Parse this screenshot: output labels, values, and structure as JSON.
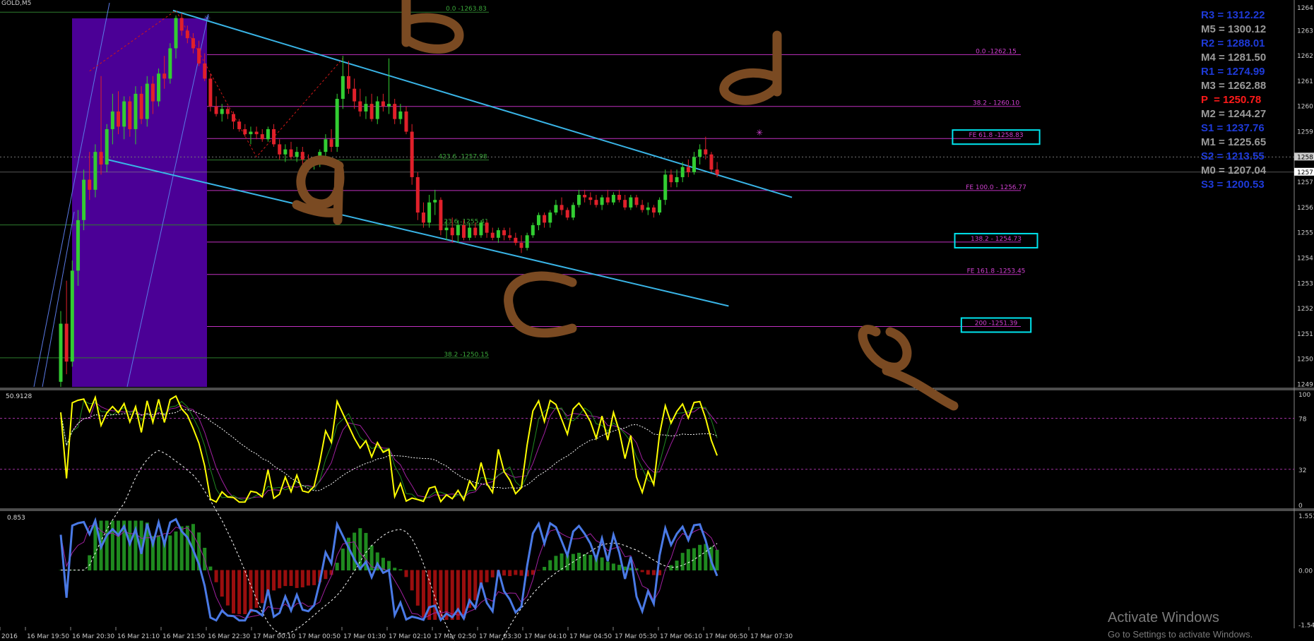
{
  "window": {
    "symbol": "GOLD,M5"
  },
  "colors": {
    "background": "#000000",
    "bull_candle": "#32cd32",
    "bear_candle": "#e0202a",
    "channel": "#39b4e6",
    "fib_magenta": "#c030c0",
    "fib_green": "#2e7d2e",
    "session_box": "#4b0096",
    "handwriting": "#7a4a22",
    "oscillator_main": "#ffff00",
    "oscillator_signal": "#ffffff",
    "macd_line": "#4a7ae6",
    "hist_up": "#1f8a1f",
    "hist_down": "#9a0e0e",
    "box_highlight": "#00e5ee"
  },
  "pivots": [
    {
      "label": "R3",
      "value": "1312.22",
      "color": "#1e3ad8"
    },
    {
      "label": "M5",
      "value": "1300.12",
      "color": "#9a9a9a"
    },
    {
      "label": "R2",
      "value": "1288.01",
      "color": "#1e3ad8"
    },
    {
      "label": "M4",
      "value": "1281.50",
      "color": "#9a9a9a"
    },
    {
      "label": "R1",
      "value": "1274.99",
      "color": "#1e3ad8"
    },
    {
      "label": "M3",
      "value": "1262.88",
      "color": "#9a9a9a"
    },
    {
      "label": "P",
      "value": "1250.78",
      "color": "#ff1a1a"
    },
    {
      "label": "M2",
      "value": "1244.27",
      "color": "#9a9a9a"
    },
    {
      "label": "S1",
      "value": "1237.76",
      "color": "#1e3ad8"
    },
    {
      "label": "M1",
      "value": "1225.65",
      "color": "#9a9a9a"
    },
    {
      "label": "S2",
      "value": "1213.55",
      "color": "#1e3ad8"
    },
    {
      "label": "M0",
      "value": "1207.04",
      "color": "#9a9a9a"
    },
    {
      "label": "S3",
      "value": "1200.53",
      "color": "#1e3ad8"
    }
  ],
  "handwritten_labels": [
    "b",
    "a",
    "d",
    "c",
    "e"
  ],
  "chart_data": {
    "type": "candlestick",
    "price_axis": {
      "ticks": [
        "1264",
        "1263",
        "1262",
        "1261",
        "1260",
        "1259",
        "1258",
        "1257",
        "1256",
        "1255",
        "1254",
        "1253",
        "1252",
        "1251",
        "1250",
        "1249"
      ],
      "tick_values": [
        1264.0,
        1263.1,
        1262.1,
        1261.1,
        1260.1,
        1259.1,
        1258.1,
        1257.1,
        1256.1,
        1255.1,
        1254.1,
        1253.1,
        1252.1,
        1251.1,
        1250.1,
        1249.1
      ],
      "ylim": [
        1249.0,
        1264.2
      ],
      "current_price_tag": "1257",
      "bid_tag": "1258"
    },
    "time_axis": [
      "2016",
      "16 Mar 19:50",
      "16 Mar 20:30",
      "16 Mar 21:10",
      "16 Mar 21:50",
      "16 Mar 22:30",
      "17 Mar 00:10",
      "17 Mar 00:50",
      "17 Mar 01:30",
      "17 Mar 02:10",
      "17 Mar 02:50",
      "17 Mar 03:30",
      "17 Mar 04:10",
      "17 Mar 04:50",
      "17 Mar 05:30",
      "17 Mar 06:10",
      "17 Mar 06:50",
      "17 Mar 07:30"
    ],
    "fib_levels": [
      {
        "label": "0.0 -1263.83",
        "price": 1263.83,
        "color": "green",
        "x_data": 0.38,
        "extends_left": true
      },
      {
        "label": "0.0 -1262.15",
        "price": 1262.15,
        "color": "magenta",
        "x_data": 0.8
      },
      {
        "label": "38.2 - 1260.10",
        "price": 1260.1,
        "color": "magenta",
        "x_data": 0.8
      },
      {
        "label": "FE 61.8 -1258.83",
        "price": 1258.83,
        "color": "magenta",
        "x_data": 0.8,
        "boxed": true
      },
      {
        "label": "423.6 -1257.98",
        "price": 1257.98,
        "color": "green",
        "x_data": 0.38
      },
      {
        "label": "FE 100.0 - 1256.77",
        "price": 1256.77,
        "color": "magenta",
        "x_data": 0.8
      },
      {
        "label": "23.6 -1255.41",
        "price": 1255.41,
        "color": "green",
        "x_data": 0.38,
        "extends_left": true
      },
      {
        "label": "138.2 - 1254.73",
        "price": 1254.73,
        "color": "magenta",
        "x_data": 0.8,
        "boxed": true
      },
      {
        "label": "FE 161.8 -1253.45",
        "price": 1253.45,
        "color": "magenta",
        "x_data": 0.8
      },
      {
        "label": "200 -1251.39",
        "price": 1251.39,
        "color": "magenta",
        "x_data": 0.8,
        "boxed": true
      },
      {
        "label": "38.2 -1250.15",
        "price": 1250.15,
        "color": "green",
        "x_data": 0.38,
        "extends_left": true
      }
    ],
    "candles": [
      {
        "o": 1249.2,
        "h": 1252.0,
        "l": 1249.0,
        "c": 1251.5
      },
      {
        "o": 1251.5,
        "h": 1253.2,
        "l": 1249.5,
        "c": 1250.0
      },
      {
        "o": 1250.0,
        "h": 1254.0,
        "l": 1249.8,
        "c": 1253.6
      },
      {
        "o": 1253.6,
        "h": 1256.0,
        "l": 1253.0,
        "c": 1255.6
      },
      {
        "o": 1255.6,
        "h": 1257.6,
        "l": 1255.2,
        "c": 1257.2
      },
      {
        "o": 1257.2,
        "h": 1258.3,
        "l": 1256.4,
        "c": 1256.8
      },
      {
        "o": 1256.8,
        "h": 1258.6,
        "l": 1256.5,
        "c": 1258.3
      },
      {
        "o": 1258.3,
        "h": 1261.3,
        "l": 1257.4,
        "c": 1257.8
      },
      {
        "o": 1257.8,
        "h": 1259.4,
        "l": 1257.5,
        "c": 1259.2
      },
      {
        "o": 1259.2,
        "h": 1260.6,
        "l": 1258.6,
        "c": 1259.9
      },
      {
        "o": 1259.9,
        "h": 1260.7,
        "l": 1259.0,
        "c": 1259.3
      },
      {
        "o": 1259.3,
        "h": 1260.5,
        "l": 1258.8,
        "c": 1260.3
      },
      {
        "o": 1260.3,
        "h": 1260.5,
        "l": 1258.9,
        "c": 1259.2
      },
      {
        "o": 1259.2,
        "h": 1260.9,
        "l": 1258.6,
        "c": 1260.6
      },
      {
        "o": 1260.6,
        "h": 1260.9,
        "l": 1259.4,
        "c": 1259.6
      },
      {
        "o": 1259.6,
        "h": 1261.3,
        "l": 1259.3,
        "c": 1261.0
      },
      {
        "o": 1261.0,
        "h": 1261.3,
        "l": 1259.8,
        "c": 1260.3
      },
      {
        "o": 1260.3,
        "h": 1261.6,
        "l": 1260.1,
        "c": 1261.4
      },
      {
        "o": 1261.4,
        "h": 1262.1,
        "l": 1260.8,
        "c": 1261.2
      },
      {
        "o": 1261.2,
        "h": 1262.6,
        "l": 1261.0,
        "c": 1262.4
      },
      {
        "o": 1262.4,
        "h": 1263.7,
        "l": 1262.0,
        "c": 1263.6
      },
      {
        "o": 1263.6,
        "h": 1263.8,
        "l": 1262.9,
        "c": 1263.1
      },
      {
        "o": 1263.1,
        "h": 1263.3,
        "l": 1262.6,
        "c": 1262.8
      },
      {
        "o": 1262.8,
        "h": 1263.0,
        "l": 1262.2,
        "c": 1262.4
      },
      {
        "o": 1262.4,
        "h": 1262.7,
        "l": 1261.7,
        "c": 1261.8
      },
      {
        "o": 1261.8,
        "h": 1262.2,
        "l": 1261.1,
        "c": 1261.2
      },
      {
        "o": 1261.2,
        "h": 1261.4,
        "l": 1259.9,
        "c": 1260.1
      },
      {
        "o": 1260.1,
        "h": 1260.5,
        "l": 1259.7,
        "c": 1259.8
      },
      {
        "o": 1259.8,
        "h": 1260.2,
        "l": 1259.5,
        "c": 1260.0
      },
      {
        "o": 1260.0,
        "h": 1260.1,
        "l": 1259.6,
        "c": 1259.8
      },
      {
        "o": 1259.8,
        "h": 1259.9,
        "l": 1259.2,
        "c": 1259.5
      },
      {
        "o": 1259.5,
        "h": 1259.6,
        "l": 1259.1,
        "c": 1259.2
      },
      {
        "o": 1259.2,
        "h": 1259.4,
        "l": 1258.9,
        "c": 1259.0
      },
      {
        "o": 1259.0,
        "h": 1259.3,
        "l": 1258.6,
        "c": 1259.1
      },
      {
        "o": 1259.1,
        "h": 1259.3,
        "l": 1258.8,
        "c": 1259.0
      },
      {
        "o": 1259.0,
        "h": 1259.2,
        "l": 1258.7,
        "c": 1258.8
      },
      {
        "o": 1258.8,
        "h": 1259.3,
        "l": 1258.7,
        "c": 1259.2
      },
      {
        "o": 1259.2,
        "h": 1259.4,
        "l": 1258.5,
        "c": 1258.6
      },
      {
        "o": 1258.6,
        "h": 1258.8,
        "l": 1258.0,
        "c": 1258.2
      },
      {
        "o": 1258.2,
        "h": 1258.6,
        "l": 1257.9,
        "c": 1258.4
      },
      {
        "o": 1258.4,
        "h": 1258.7,
        "l": 1258.0,
        "c": 1258.1
      },
      {
        "o": 1258.1,
        "h": 1258.5,
        "l": 1257.9,
        "c": 1258.3
      },
      {
        "o": 1258.3,
        "h": 1258.5,
        "l": 1257.8,
        "c": 1258.0
      },
      {
        "o": 1258.0,
        "h": 1258.2,
        "l": 1257.6,
        "c": 1257.8
      },
      {
        "o": 1257.8,
        "h": 1258.0,
        "l": 1257.6,
        "c": 1257.9
      },
      {
        "o": 1257.9,
        "h": 1258.4,
        "l": 1257.7,
        "c": 1258.3
      },
      {
        "o": 1258.3,
        "h": 1259.0,
        "l": 1258.0,
        "c": 1258.8
      },
      {
        "o": 1258.8,
        "h": 1259.2,
        "l": 1258.3,
        "c": 1258.5
      },
      {
        "o": 1258.5,
        "h": 1260.6,
        "l": 1258.3,
        "c": 1260.4
      },
      {
        "o": 1260.4,
        "h": 1262.1,
        "l": 1260.0,
        "c": 1261.3
      },
      {
        "o": 1261.3,
        "h": 1261.9,
        "l": 1260.6,
        "c": 1260.8
      },
      {
        "o": 1260.8,
        "h": 1261.2,
        "l": 1260.0,
        "c": 1260.3
      },
      {
        "o": 1260.3,
        "h": 1260.8,
        "l": 1259.7,
        "c": 1259.9
      },
      {
        "o": 1259.9,
        "h": 1260.5,
        "l": 1259.6,
        "c": 1260.2
      },
      {
        "o": 1260.2,
        "h": 1260.6,
        "l": 1259.5,
        "c": 1259.6
      },
      {
        "o": 1259.6,
        "h": 1260.5,
        "l": 1259.4,
        "c": 1260.3
      },
      {
        "o": 1260.3,
        "h": 1260.6,
        "l": 1259.9,
        "c": 1260.1
      },
      {
        "o": 1260.1,
        "h": 1262.0,
        "l": 1259.8,
        "c": 1260.2
      },
      {
        "o": 1260.2,
        "h": 1260.4,
        "l": 1259.4,
        "c": 1259.6
      },
      {
        "o": 1259.6,
        "h": 1260.2,
        "l": 1259.4,
        "c": 1259.9
      },
      {
        "o": 1259.9,
        "h": 1260.1,
        "l": 1259.0,
        "c": 1259.1
      },
      {
        "o": 1259.1,
        "h": 1259.4,
        "l": 1257.0,
        "c": 1257.3
      },
      {
        "o": 1257.3,
        "h": 1257.5,
        "l": 1255.6,
        "c": 1255.9
      },
      {
        "o": 1255.9,
        "h": 1256.3,
        "l": 1255.3,
        "c": 1255.5
      },
      {
        "o": 1255.5,
        "h": 1256.6,
        "l": 1255.3,
        "c": 1256.3
      },
      {
        "o": 1256.3,
        "h": 1256.8,
        "l": 1255.8,
        "c": 1256.4
      },
      {
        "o": 1256.4,
        "h": 1256.5,
        "l": 1255.0,
        "c": 1255.2
      },
      {
        "o": 1255.2,
        "h": 1255.6,
        "l": 1254.8,
        "c": 1255.3
      },
      {
        "o": 1255.3,
        "h": 1255.7,
        "l": 1254.7,
        "c": 1255.0
      },
      {
        "o": 1255.0,
        "h": 1255.6,
        "l": 1254.7,
        "c": 1255.4
      },
      {
        "o": 1255.4,
        "h": 1255.6,
        "l": 1254.8,
        "c": 1254.9
      },
      {
        "o": 1254.9,
        "h": 1255.5,
        "l": 1254.8,
        "c": 1255.3
      },
      {
        "o": 1255.3,
        "h": 1255.5,
        "l": 1254.9,
        "c": 1255.0
      },
      {
        "o": 1255.0,
        "h": 1255.6,
        "l": 1254.9,
        "c": 1255.5
      },
      {
        "o": 1255.5,
        "h": 1255.6,
        "l": 1254.9,
        "c": 1255.1
      },
      {
        "o": 1255.1,
        "h": 1255.3,
        "l": 1254.8,
        "c": 1254.9
      },
      {
        "o": 1254.9,
        "h": 1255.3,
        "l": 1254.7,
        "c": 1255.2
      },
      {
        "o": 1255.2,
        "h": 1255.3,
        "l": 1254.8,
        "c": 1255.0
      },
      {
        "o": 1255.0,
        "h": 1255.3,
        "l": 1254.8,
        "c": 1254.9
      },
      {
        "o": 1254.9,
        "h": 1255.1,
        "l": 1254.6,
        "c": 1254.7
      },
      {
        "o": 1254.7,
        "h": 1255.0,
        "l": 1254.3,
        "c": 1254.5
      },
      {
        "o": 1254.5,
        "h": 1255.1,
        "l": 1254.4,
        "c": 1255.0
      },
      {
        "o": 1255.0,
        "h": 1255.5,
        "l": 1254.9,
        "c": 1255.4
      },
      {
        "o": 1255.4,
        "h": 1255.9,
        "l": 1255.2,
        "c": 1255.8
      },
      {
        "o": 1255.8,
        "h": 1255.9,
        "l": 1255.3,
        "c": 1255.5
      },
      {
        "o": 1255.5,
        "h": 1256.0,
        "l": 1255.3,
        "c": 1255.9
      },
      {
        "o": 1255.9,
        "h": 1256.4,
        "l": 1255.8,
        "c": 1256.2
      },
      {
        "o": 1256.2,
        "h": 1256.5,
        "l": 1255.8,
        "c": 1256.0
      },
      {
        "o": 1256.0,
        "h": 1256.1,
        "l": 1255.6,
        "c": 1255.7
      },
      {
        "o": 1255.7,
        "h": 1256.3,
        "l": 1255.6,
        "c": 1256.2
      },
      {
        "o": 1256.2,
        "h": 1256.8,
        "l": 1256.1,
        "c": 1256.6
      },
      {
        "o": 1256.6,
        "h": 1256.8,
        "l": 1256.3,
        "c": 1256.5
      },
      {
        "o": 1256.5,
        "h": 1256.7,
        "l": 1256.2,
        "c": 1256.4
      },
      {
        "o": 1256.4,
        "h": 1256.6,
        "l": 1256.1,
        "c": 1256.2
      },
      {
        "o": 1256.2,
        "h": 1256.6,
        "l": 1256.0,
        "c": 1256.5
      },
      {
        "o": 1256.5,
        "h": 1256.8,
        "l": 1256.2,
        "c": 1256.3
      },
      {
        "o": 1256.3,
        "h": 1256.7,
        "l": 1256.2,
        "c": 1256.6
      },
      {
        "o": 1256.6,
        "h": 1256.8,
        "l": 1256.3,
        "c": 1256.4
      },
      {
        "o": 1256.4,
        "h": 1256.6,
        "l": 1256.0,
        "c": 1256.1
      },
      {
        "o": 1256.1,
        "h": 1256.6,
        "l": 1256.0,
        "c": 1256.5
      },
      {
        "o": 1256.5,
        "h": 1256.6,
        "l": 1256.1,
        "c": 1256.2
      },
      {
        "o": 1256.2,
        "h": 1256.4,
        "l": 1255.9,
        "c": 1256.0
      },
      {
        "o": 1256.0,
        "h": 1256.3,
        "l": 1255.8,
        "c": 1256.1
      },
      {
        "o": 1256.1,
        "h": 1256.2,
        "l": 1255.7,
        "c": 1255.9
      },
      {
        "o": 1255.9,
        "h": 1256.5,
        "l": 1255.8,
        "c": 1256.4
      },
      {
        "o": 1256.4,
        "h": 1257.6,
        "l": 1256.2,
        "c": 1257.4
      },
      {
        "o": 1257.4,
        "h": 1257.6,
        "l": 1256.9,
        "c": 1257.1
      },
      {
        "o": 1257.1,
        "h": 1257.6,
        "l": 1256.9,
        "c": 1257.3
      },
      {
        "o": 1257.3,
        "h": 1257.9,
        "l": 1257.1,
        "c": 1257.7
      },
      {
        "o": 1257.7,
        "h": 1258.0,
        "l": 1257.3,
        "c": 1257.5
      },
      {
        "o": 1257.5,
        "h": 1258.3,
        "l": 1257.4,
        "c": 1258.1
      },
      {
        "o": 1258.1,
        "h": 1258.6,
        "l": 1257.8,
        "c": 1258.4
      },
      {
        "o": 1258.4,
        "h": 1258.9,
        "l": 1258.0,
        "c": 1258.2
      },
      {
        "o": 1258.2,
        "h": 1258.3,
        "l": 1257.5,
        "c": 1257.6
      },
      {
        "o": 1257.6,
        "h": 1257.9,
        "l": 1257.3,
        "c": 1257.4
      }
    ],
    "channel": {
      "upper": {
        "from": {
          "i": 19.5,
          "p": 1263.9
        },
        "to": {
          "i": 127,
          "p": 1256.5
        }
      },
      "lower": {
        "from": {
          "i": 8,
          "p": 1258.0
        },
        "to": {
          "i": 116,
          "p": 1252.2
        }
      }
    },
    "stochastic": {
      "label": "50.9128",
      "ylim": [
        0,
        100
      ],
      "ticks": [
        "100",
        "78",
        "32",
        "0"
      ],
      "tick_values": [
        100,
        78,
        32,
        0
      ],
      "levels": [
        78,
        32
      ]
    },
    "macd": {
      "label": "0.853",
      "ylim": [
        -1.55,
        1.55
      ],
      "ticks": [
        "1.551",
        "0.00",
        "-1.54"
      ],
      "tick_values": [
        1.55,
        0.0,
        -1.54
      ]
    }
  },
  "watermark": {
    "title": "Activate Windows",
    "subtitle": "Go to Settings to activate Windows."
  }
}
